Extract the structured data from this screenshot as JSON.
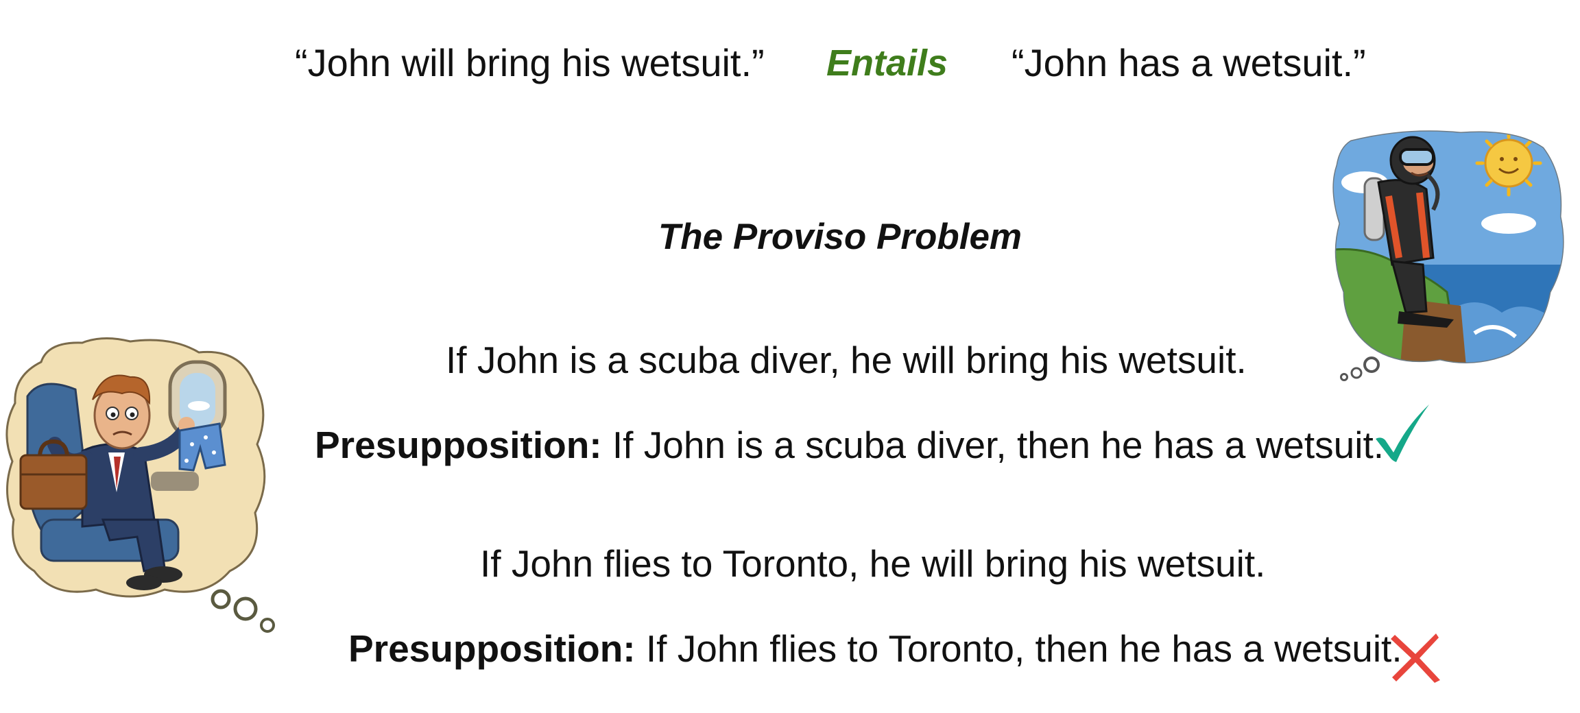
{
  "entailment": {
    "premise": "“John will bring his wetsuit.”",
    "relation": "Entails",
    "hypothesis": "“John has a wetsuit.”"
  },
  "title": "The Proviso Problem",
  "examples": [
    {
      "sentence": "If John is a scuba diver, he will bring his wetsuit.",
      "presupposition_label": "Presupposition:",
      "presupposition_text": " If John is a scuba diver, then he has a wetsuit.",
      "verdict_icon": "check-mark-icon"
    },
    {
      "sentence": "If John flies to Toronto, he will bring his wetsuit.",
      "presupposition_label": "Presupposition:",
      "presupposition_text": " If John flies to Toronto, then he has a wetsuit.",
      "verdict_icon": "cross-mark-icon"
    }
  ],
  "colors": {
    "entails": "#3f7d1c",
    "check": "#15a889",
    "cross": "#e8453c"
  },
  "illustrations": {
    "left": "traveler-on-plane-illustration",
    "right": "scuba-diver-on-cliff-illustration"
  }
}
